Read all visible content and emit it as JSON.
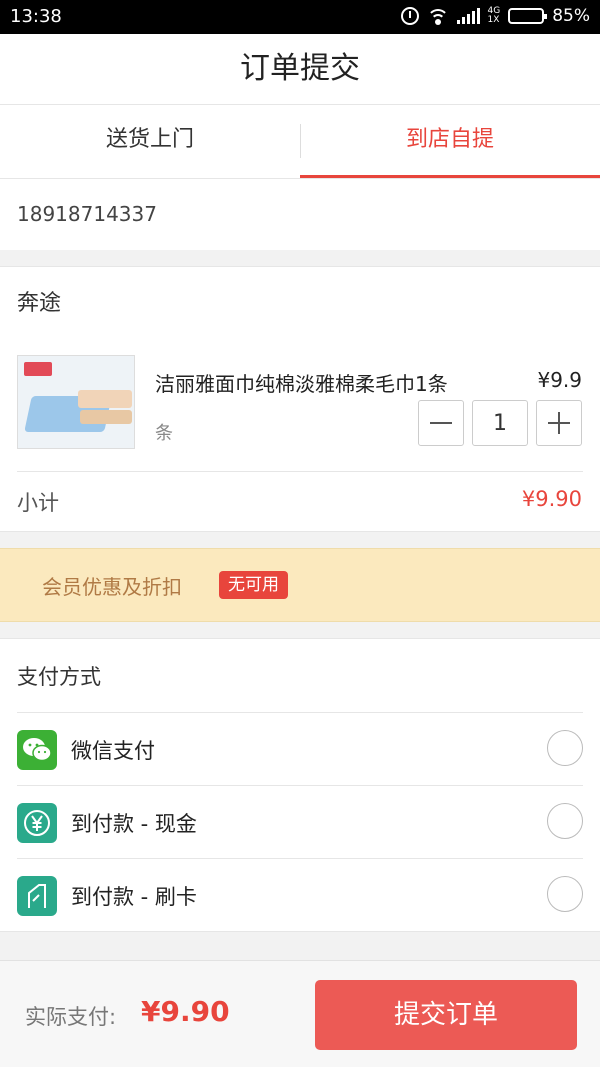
{
  "status_bar": {
    "time": "13:38",
    "network": [
      "4G",
      "1X"
    ],
    "battery": "85%"
  },
  "header": {
    "title": "订单提交"
  },
  "tabs": [
    {
      "label": "送货上门",
      "active": false
    },
    {
      "label": "到店自提",
      "active": true
    }
  ],
  "contact": {
    "phone": "18918714337"
  },
  "store": {
    "name": "奔途",
    "product": {
      "name": "洁丽雅面巾纯棉淡雅棉柔毛巾1条",
      "price": "¥9.9",
      "unit": "条",
      "quantity": "1"
    },
    "subtotal_label": "小计",
    "subtotal_value": "¥9.90"
  },
  "member": {
    "label": "会员优惠及折扣",
    "badge": "无可用"
  },
  "payment": {
    "title": "支付方式",
    "options": [
      {
        "label": "微信支付",
        "icon": "wechat-icon"
      },
      {
        "label": "到付款 - 现金",
        "icon": "cash-icon"
      },
      {
        "label": "到付款 - 刷卡",
        "icon": "card-icon"
      }
    ]
  },
  "footer": {
    "total_label": "实际支付:",
    "total_value": "¥9.90",
    "submit_label": "提交订单"
  },
  "colors": {
    "accent": "#e8453c",
    "member_bg": "#fbe9be",
    "wechat": "#3cb035",
    "cash": "#2aa98b"
  }
}
